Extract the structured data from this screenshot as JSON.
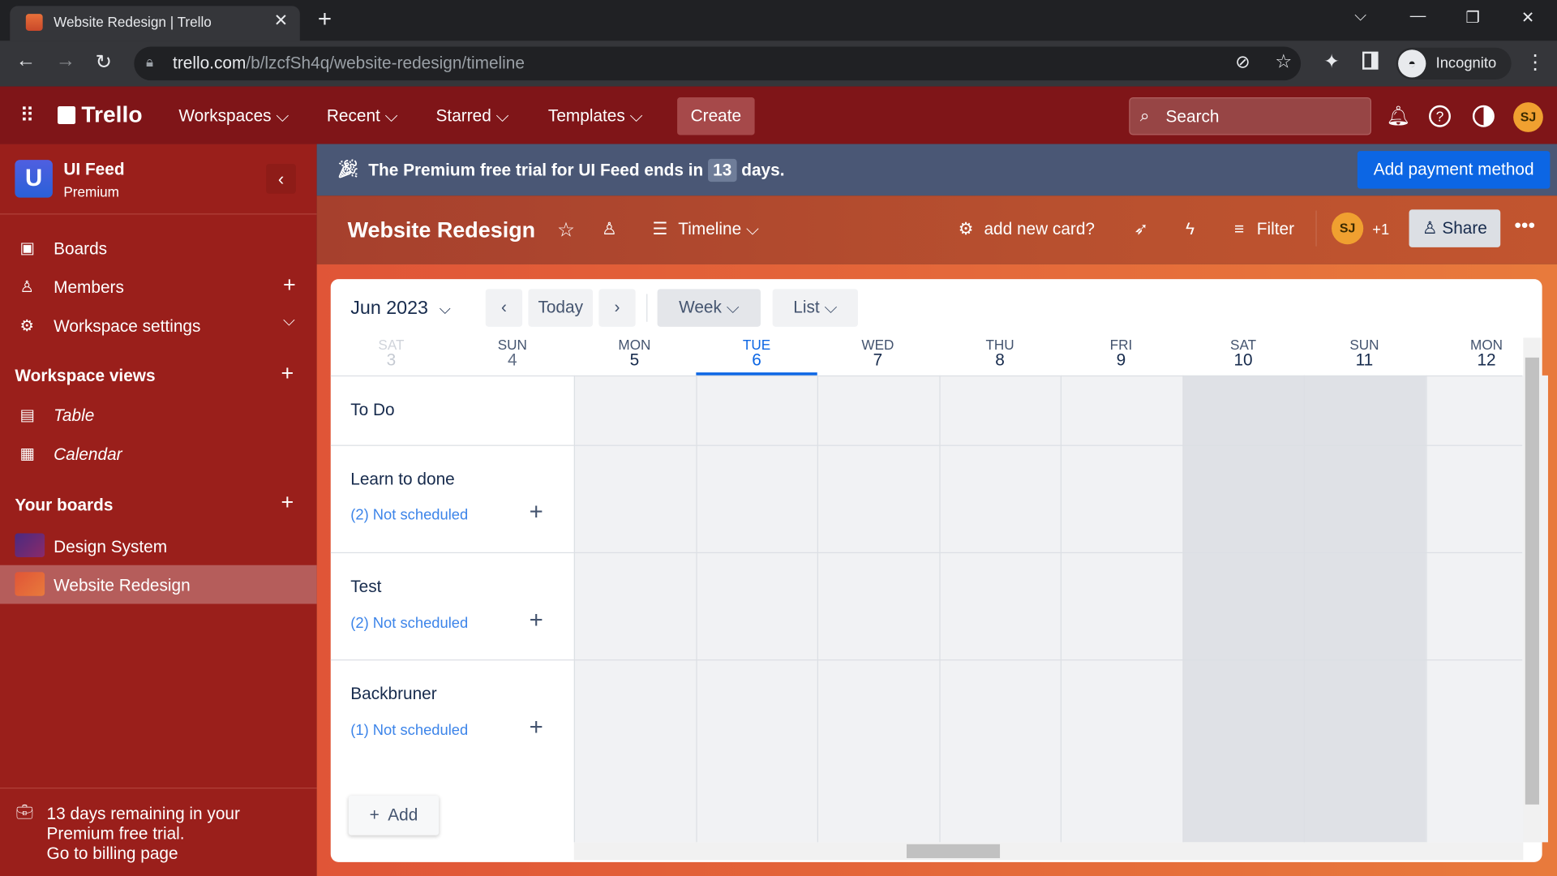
{
  "browser": {
    "tab_title": "Website Redesign | Trello",
    "url_host": "trello.com",
    "url_path": "/b/lzcfSh4q/website-redesign/timeline",
    "profile": "Incognito"
  },
  "header": {
    "logo": "Trello",
    "menus": [
      "Workspaces",
      "Recent",
      "Starred",
      "Templates"
    ],
    "create": "Create",
    "search_placeholder": "Search",
    "avatar": "SJ"
  },
  "sidebar": {
    "workspace": "UI Feed",
    "workspace_initial": "U",
    "plan": "Premium",
    "items": [
      {
        "label": "Boards"
      },
      {
        "label": "Members"
      },
      {
        "label": "Workspace settings"
      }
    ],
    "views_title": "Workspace views",
    "views": [
      {
        "label": "Table"
      },
      {
        "label": "Calendar"
      }
    ],
    "boards_title": "Your boards",
    "boards": [
      {
        "label": "Design System"
      },
      {
        "label": "Website Redesign"
      }
    ],
    "trial": [
      "13 days remaining in your",
      "Premium free trial.",
      "Go to billing page"
    ]
  },
  "banner": {
    "text_before": "The Premium free trial for UI Feed ends in",
    "days": "13",
    "text_after": "days.",
    "button": "Add payment method"
  },
  "board": {
    "title": "Website Redesign",
    "view": "Timeline",
    "automation": "add new card?",
    "filter": "Filter",
    "member": "SJ",
    "more_members": "+1",
    "share": "Share"
  },
  "timeline": {
    "month": "Jun 2023",
    "today": "Today",
    "scale": "Week",
    "group": "List",
    "days": [
      {
        "dow": "SAT",
        "num": "3"
      },
      {
        "dow": "SUN",
        "num": "4"
      },
      {
        "dow": "MON",
        "num": "5"
      },
      {
        "dow": "TUE",
        "num": "6"
      },
      {
        "dow": "WED",
        "num": "7"
      },
      {
        "dow": "THU",
        "num": "8"
      },
      {
        "dow": "FRI",
        "num": "9"
      },
      {
        "dow": "SAT",
        "num": "10"
      },
      {
        "dow": "SUN",
        "num": "11"
      },
      {
        "dow": "MON",
        "num": "12"
      }
    ],
    "lists": [
      {
        "name": "To Do"
      },
      {
        "name": "Learn to done",
        "unscheduled": "(2) Not scheduled"
      },
      {
        "name": "Test",
        "unscheduled": "(2) Not scheduled"
      },
      {
        "name": "Backbruner",
        "unscheduled": "(1) Not scheduled"
      }
    ],
    "add": "Add"
  },
  "colors": {
    "header": "#7f1518",
    "sidebar": "#9a1f1b",
    "banner": "#4a5775",
    "accent": "#0c66e4"
  }
}
